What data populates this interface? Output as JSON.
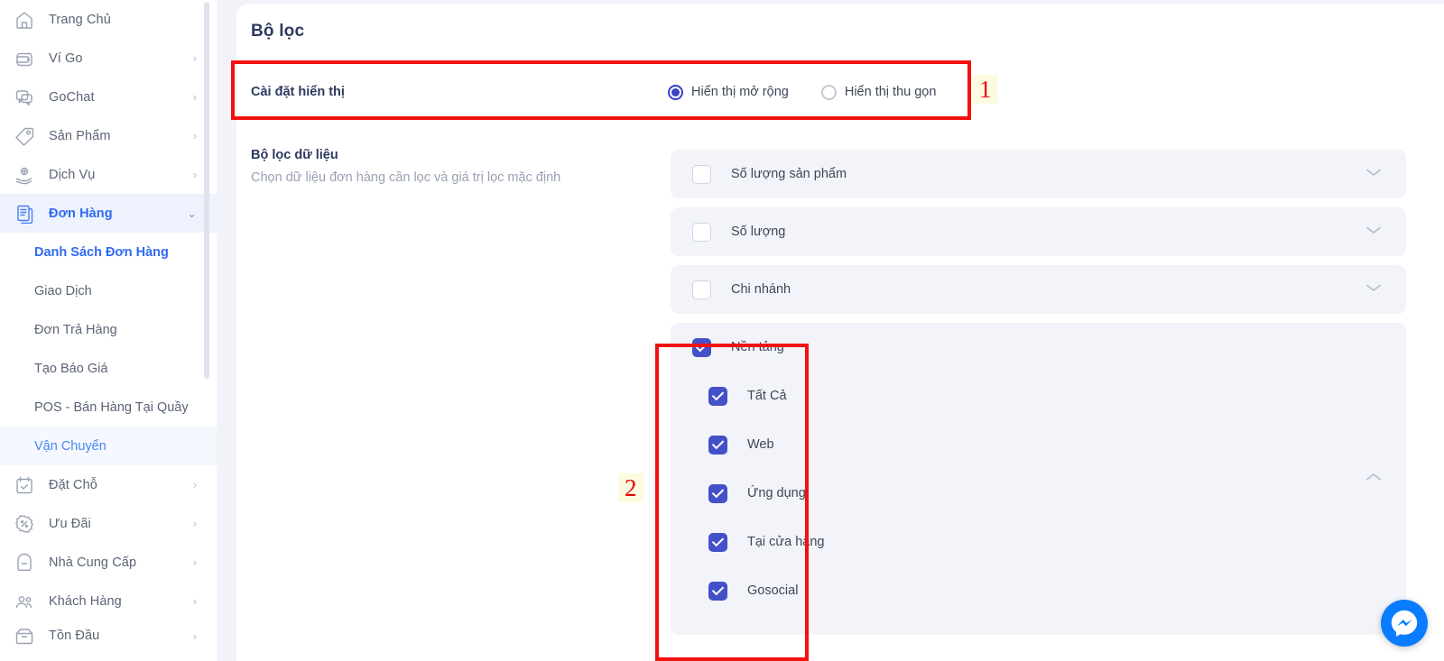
{
  "sidebar": {
    "items": [
      {
        "label": "Trang Chủ",
        "icon": "home-icon",
        "chevron": "",
        "state": "normal"
      },
      {
        "label": "Ví Go",
        "icon": "wallet-icon",
        "chevron": "›",
        "state": "normal"
      },
      {
        "label": "GoChat",
        "icon": "chat-icon",
        "chevron": "›",
        "state": "normal"
      },
      {
        "label": "Sản Phẩm",
        "icon": "tag-icon",
        "chevron": "›",
        "state": "normal"
      },
      {
        "label": "Dịch Vụ",
        "icon": "service-icon",
        "chevron": "›",
        "state": "normal"
      },
      {
        "label": "Đơn Hàng",
        "icon": "orders-icon",
        "chevron": "⌄",
        "state": "active"
      }
    ],
    "sub_items": [
      {
        "label": "Danh Sách Đơn Hàng",
        "state": "current"
      },
      {
        "label": "Giao Dịch",
        "state": "normal"
      },
      {
        "label": "Đơn Trả Hàng",
        "state": "normal"
      },
      {
        "label": "Tạo Báo Giá",
        "state": "normal"
      },
      {
        "label": "POS - Bán Hàng Tại Quầy",
        "state": "normal"
      },
      {
        "label": "Vận Chuyển",
        "state": "hover"
      }
    ],
    "items_after": [
      {
        "label": "Đặt Chỗ",
        "icon": "calendar-check-icon",
        "chevron": "›",
        "state": "normal"
      },
      {
        "label": "Ưu Đãi",
        "icon": "percent-badge-icon",
        "chevron": "›",
        "state": "normal"
      },
      {
        "label": "Nhà Cung Cấp",
        "icon": "supplier-icon",
        "chevron": "›",
        "state": "normal"
      },
      {
        "label": "Khách Hàng",
        "icon": "customers-icon",
        "chevron": "›",
        "state": "normal"
      },
      {
        "label": "Tồn Đầu",
        "icon": "inventory-icon",
        "chevron": "›",
        "state": "partial"
      }
    ]
  },
  "main": {
    "page_title": "Bộ lọc",
    "display_setting": {
      "label": "Cài đặt hiển thị",
      "options": [
        {
          "label": "Hiển thị mở rộng",
          "selected": true
        },
        {
          "label": "Hiển thị thu gọn",
          "selected": false
        }
      ]
    },
    "data_filter": {
      "title": "Bộ lọc dữ liệu",
      "subtitle": "Chọn dữ liệu đơn hàng cần lọc và giá trị lọc mặc định"
    },
    "accordions": [
      {
        "label": "Số lượng sản phẩm",
        "checked": false,
        "expanded": false,
        "chevron": "chevron-down-icon"
      },
      {
        "label": "Số lượng",
        "checked": false,
        "expanded": false,
        "chevron": "chevron-down-icon"
      },
      {
        "label": "Chi nhánh",
        "checked": false,
        "expanded": false,
        "chevron": "chevron-down-icon"
      },
      {
        "label": "Nền tảng",
        "checked": true,
        "expanded": true,
        "chevron": "chevron-up-icon",
        "options": [
          {
            "label": "Tất Cả",
            "checked": true
          },
          {
            "label": "Web",
            "checked": true
          },
          {
            "label": "Ứng dụng",
            "checked": true
          },
          {
            "label": "Tại cửa hàng",
            "checked": true
          },
          {
            "label": "Gosocial",
            "checked": true
          }
        ]
      }
    ]
  },
  "annotations": [
    {
      "number": "1",
      "target": "display-setting-row"
    },
    {
      "number": "2",
      "target": "platform-checkbox-group"
    }
  ],
  "floating": {
    "messenger_label": "messenger-icon"
  },
  "colors": {
    "accent_blue": "#2f6bf3",
    "radio_indigo": "#3a41c6",
    "checkbox_indigo": "#4450c8",
    "annotation_red": "#f41010",
    "annotation_highlight": "#fcfbe0",
    "page_bg": "#f1f3f8",
    "row_bg": "#f2f4f9",
    "messenger_blue": "#0a7cff"
  }
}
